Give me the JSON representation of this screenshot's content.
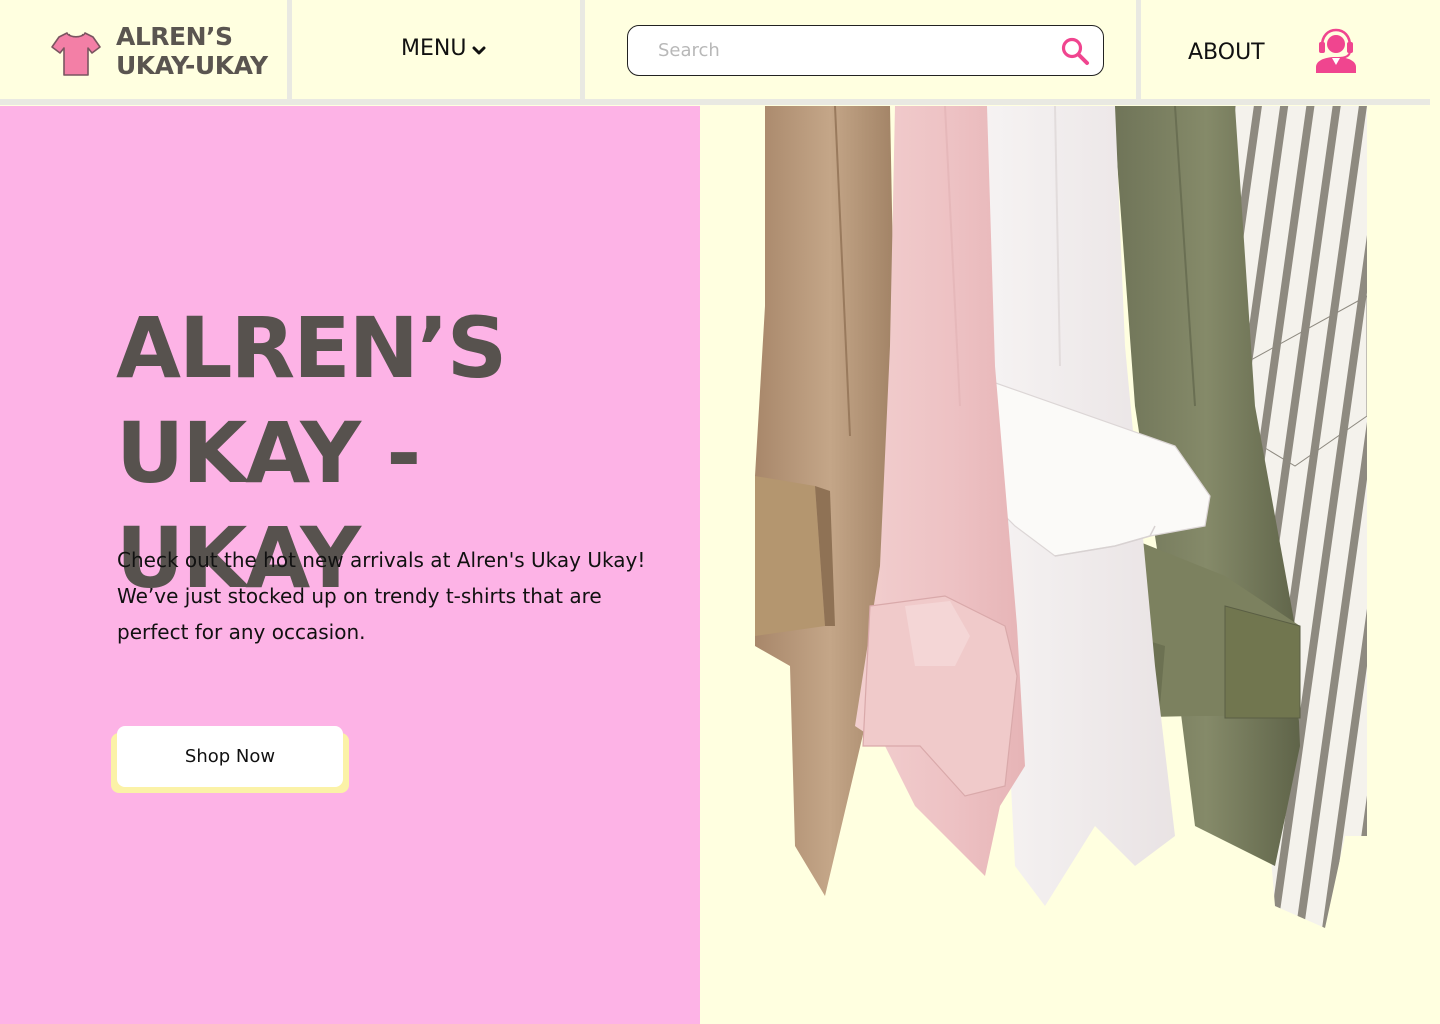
{
  "brand": {
    "name": "ALREN’S\nUKAY-UKAY",
    "accent_pink": "#F37FA6",
    "text_gray": "#57524E"
  },
  "nav": {
    "menu_label": "MENU",
    "about_label": "ABOUT",
    "search_placeholder": "Search"
  },
  "hero": {
    "title": "ALREN’S\nUKAY - UKAY",
    "description": "Check out the hot new arrivals at Alren's Ukay Ukay! We’ve just stocked up on trendy t-shirts that are perfect for any occasion.",
    "cta_label": "Shop Now",
    "left_bg": "#FDB3E6",
    "right_bg": "#FFFFE0"
  },
  "icons": {
    "logo": "tshirt-icon",
    "menu": "chevron-down-icon",
    "search": "search-icon",
    "about": "support-agent-icon"
  }
}
